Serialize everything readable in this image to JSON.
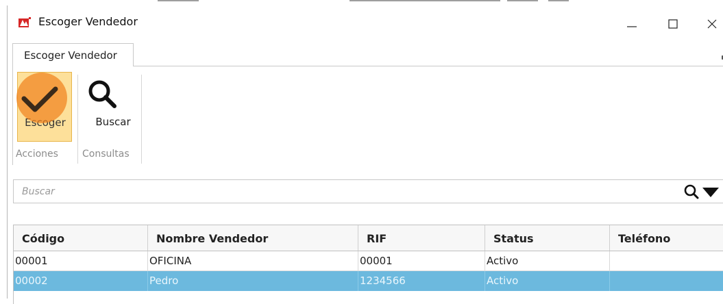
{
  "window": {
    "title": "Escoger Vendedor",
    "minimize_icon": "minimize-icon",
    "maximize_icon": "maximize-icon",
    "close_icon": "close-icon"
  },
  "ribbon": {
    "tab_label": "Escoger Vendedor",
    "buttons": [
      {
        "label": "Escoger",
        "icon": "checkmark-icon",
        "group": "Acciones"
      },
      {
        "label": "Buscar",
        "icon": "magnifier-icon",
        "group": "Consultas"
      }
    ],
    "groups": [
      "Acciones",
      "Consultas"
    ]
  },
  "search": {
    "placeholder": "Buscar",
    "search_icon": "search-icon",
    "filter_icon": "filter-dropdown-icon"
  },
  "grid": {
    "columns": [
      "Código",
      "Nombre Vendedor",
      "RIF",
      "Status",
      "Teléfono"
    ],
    "rows": [
      {
        "codigo": "00001",
        "nombre": "OFICINA",
        "rif": "00001",
        "status": "Activo",
        "telefono": ""
      },
      {
        "codigo": "00002",
        "nombre": "Pedro",
        "rif": "1234566",
        "status": "Activo",
        "telefono": ""
      }
    ],
    "selected_row_color": "#6cb9de"
  },
  "colors": {
    "highlight_button": "#fde09a",
    "click_indicator": "#f0821e"
  }
}
